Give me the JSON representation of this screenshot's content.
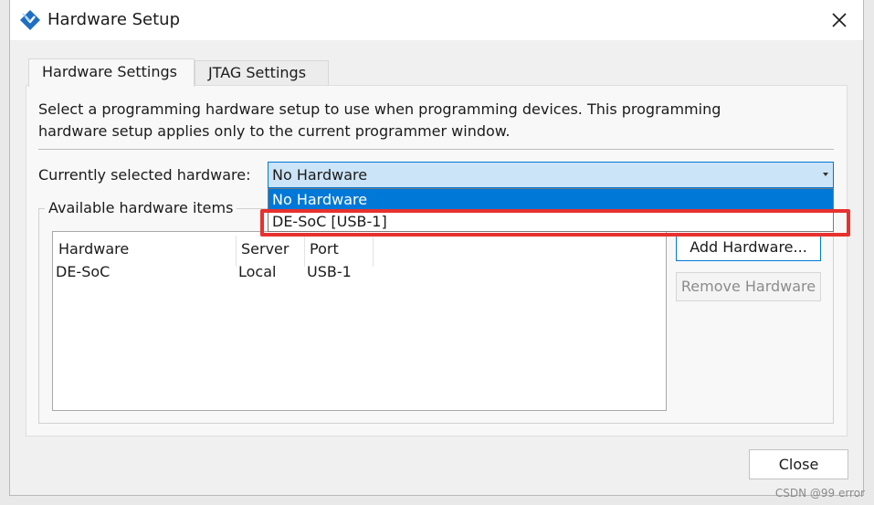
{
  "window": {
    "title": "Hardware Setup"
  },
  "tabs": [
    {
      "label": "Hardware Settings",
      "active": true
    },
    {
      "label": "JTAG Settings",
      "active": false
    }
  ],
  "panel": {
    "description": "Select a programming hardware setup to use when programming devices. This programming\nhardware setup applies only to the current programmer window.",
    "current_label": "Currently selected hardware:",
    "current_value": "No Hardware",
    "dropdown_options": [
      "No Hardware",
      "DE-SoC [USB-1]"
    ],
    "available_label": "Available hardware items"
  },
  "table": {
    "columns": [
      "Hardware",
      "Server",
      "Port"
    ],
    "rows": [
      {
        "hardware": "DE-SoC",
        "server": "Local",
        "port": "USB-1"
      }
    ]
  },
  "buttons": {
    "add": "Add Hardware...",
    "remove": "Remove Hardware",
    "close": "Close"
  },
  "watermark": "CSDN @99 error",
  "colors": {
    "accent": "#0078d7",
    "highlight": "#e8312f",
    "combo_bg": "#cce4f7"
  },
  "icons": {
    "app": "quartus-programmer-icon",
    "close": "close-icon",
    "dropdown": "chevron-down-icon"
  }
}
